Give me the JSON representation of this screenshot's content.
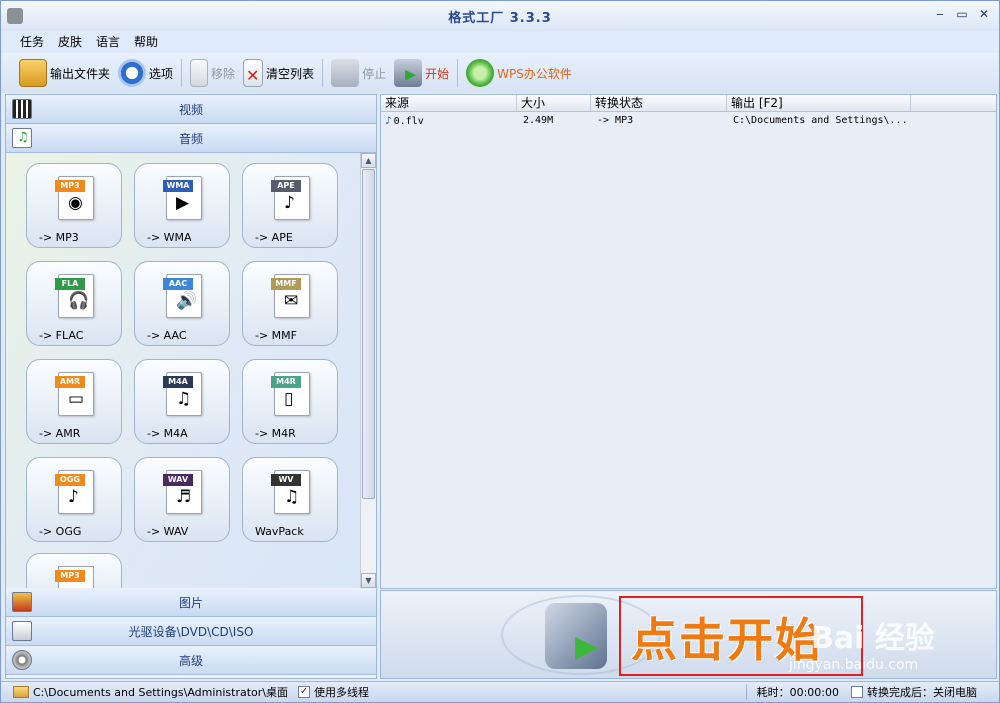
{
  "window": {
    "title": "格式工厂  3.3.3",
    "controls": [
      "‒",
      "▭",
      "✕"
    ]
  },
  "menu": [
    "任务",
    "皮肤",
    "语言",
    "帮助"
  ],
  "toolbar": {
    "output_folder": "输出文件夹",
    "options": "选项",
    "remove": "移除",
    "clear_list": "清空列表",
    "stop": "停止",
    "start": "开始",
    "wps": "WPS办公软件"
  },
  "categories": {
    "video": "视频",
    "audio": "音频",
    "picture": "图片",
    "disc": "光驱设备\\DVD\\CD\\ISO",
    "advanced": "高级"
  },
  "audio_formats": [
    {
      "tag": "MP3",
      "label": "-> MP3",
      "tag_color": "#f08a1c",
      "glyph": "◉"
    },
    {
      "tag": "WMA",
      "label": "-> WMA",
      "tag_color": "#2d5fb8",
      "glyph": "▶"
    },
    {
      "tag": "APE",
      "label": "-> APE",
      "tag_color": "#555d6a",
      "glyph": "♪"
    },
    {
      "tag": "FLA",
      "label": "-> FLAC",
      "tag_color": "#2e9b48",
      "glyph": "🎧"
    },
    {
      "tag": "AAC",
      "label": "-> AAC",
      "tag_color": "#3b86d6",
      "glyph": "🔊"
    },
    {
      "tag": "MMF",
      "label": "-> MMF",
      "tag_color": "#b09a55",
      "glyph": "✉"
    },
    {
      "tag": "AMR",
      "label": "-> AMR",
      "tag_color": "#f08a1c",
      "glyph": "▭"
    },
    {
      "tag": "M4A",
      "label": "-> M4A",
      "tag_color": "#2b3b55",
      "glyph": "♫"
    },
    {
      "tag": "M4R",
      "label": "-> M4R",
      "tag_color": "#4aa38a",
      "glyph": "▯"
    },
    {
      "tag": "OGG",
      "label": "-> OGG",
      "tag_color": "#f08a1c",
      "glyph": "♪"
    },
    {
      "tag": "WAV",
      "label": "-> WAV",
      "tag_color": "#4a2a5e",
      "glyph": "♬"
    },
    {
      "tag": "WV",
      "label": "WavPack",
      "tag_color": "#333333",
      "glyph": "♫"
    }
  ],
  "partial_tile": {
    "tag": "MP3",
    "tag_color": "#f08a1c"
  },
  "file_list": {
    "columns": [
      "来源",
      "大小",
      "转换状态",
      "输出 [F2]"
    ],
    "rows": [
      {
        "source": "0.flv",
        "size": "2.49M",
        "status": "-> MP3",
        "output": "C:\\Documents and Settings\\..."
      }
    ]
  },
  "banner": {
    "highlight_text": "点击开始",
    "watermark": "Bai 经验",
    "watermark_url": "jingyan.baidu.com"
  },
  "status": {
    "path": "C:\\Documents and Settings\\Administrator\\桌面",
    "multithread_label": "使用多线程",
    "multithread_checked": "✓",
    "elapsed": "耗时：00:00:00",
    "after_done": "转换完成后：关闭电脑"
  }
}
